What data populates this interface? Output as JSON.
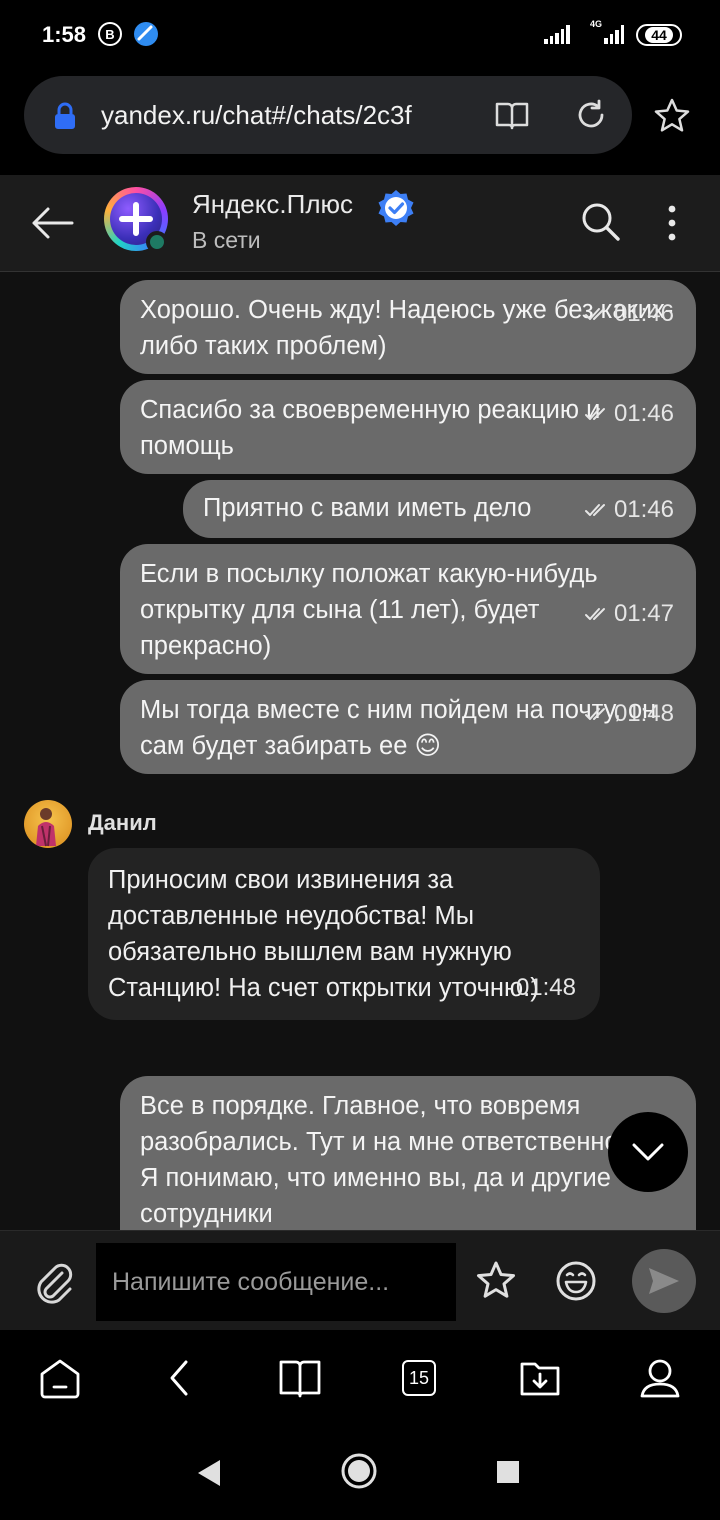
{
  "status_bar": {
    "time": "1:58",
    "b_icon_letter": "B",
    "network_label": "4G",
    "battery_level": "44"
  },
  "browser": {
    "url": "yandex.ru/chat#/chats/2c3f",
    "tabs_count": "15"
  },
  "chat": {
    "title": "Яндекс.Плюс",
    "status": "В сети"
  },
  "messages_out_top": [
    {
      "text": "Хорошо. Очень жду! Надеюсь уже без каких-либо таких проблем)",
      "time": "01:46"
    },
    {
      "text": "Спасибо за своевременную реакцию и помощь",
      "time": "01:46"
    },
    {
      "text": "Приятно с вами иметь дело",
      "time": "01:46"
    },
    {
      "text": "Если в посылку положат какую-нибудь открытку для сына (11 лет), будет прекрасно)",
      "time": "01:47"
    },
    {
      "text": "Мы тогда вместе с ним пойдем на почту, он сам будет забирать ее 😊",
      "time": "01:48"
    }
  ],
  "incoming": {
    "sender": "Данил",
    "text": "Приносим свои извинения за доставленные неудобства! Мы обязательно вышлем вам нужную Станцию! На счет открытки уточню.)",
    "time": "01:48"
  },
  "last_outgoing": {
    "text": "Все в порядке. Главное, что вовремя разобрались. Тут и на мне ответственность. Я понимаю, что именно вы, да и другие сотрудники"
  },
  "composer": {
    "placeholder": "Напишите сообщение..."
  },
  "colors": {
    "outgoing_bubble": "#6a6a6a",
    "incoming_bubble": "#232323",
    "verified_blue": "#3d7ff5",
    "lock_blue": "#2f6df5"
  }
}
